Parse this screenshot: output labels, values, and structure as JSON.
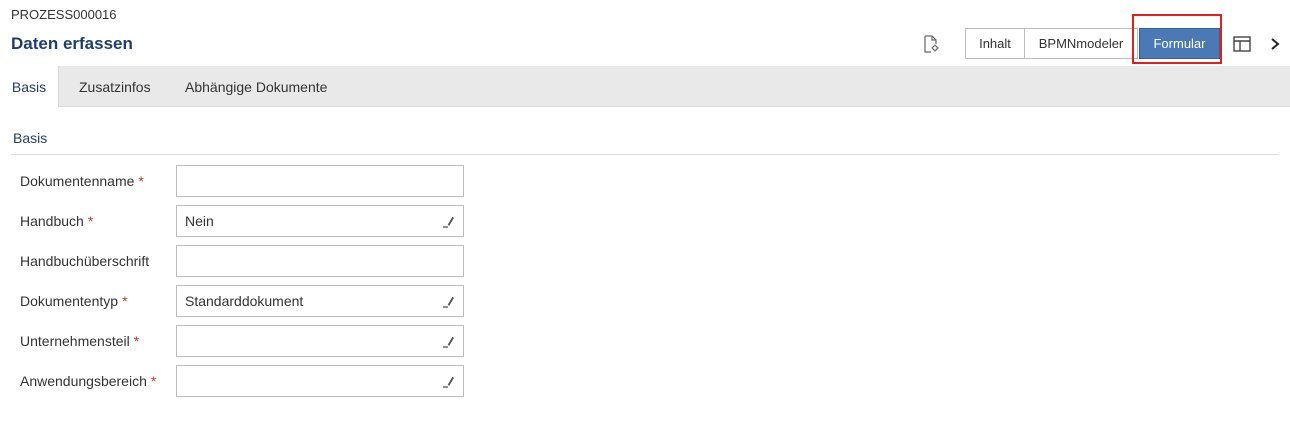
{
  "header": {
    "process_id": "PROZESS000016",
    "title": "Daten erfassen"
  },
  "toolbar": {
    "doc_icon": "document-settings-icon",
    "view_buttons": [
      "Inhalt",
      "BPMNmodeler",
      "Formular"
    ],
    "active_view": "Formular",
    "layout_icon": "panel-layout-icon",
    "more_icon": "chevron-right-icon",
    "accent_color": "#4a79b6",
    "highlight_color": "#e0201f"
  },
  "tabs": [
    {
      "label": "Basis",
      "active": true
    },
    {
      "label": "Zusatzinfos",
      "active": false
    },
    {
      "label": "Abhängige Dokumente",
      "active": false
    }
  ],
  "section": {
    "title": "Basis"
  },
  "fields": [
    {
      "label": "Dokumentenname",
      "required": "*",
      "value": "",
      "editable_picker": false
    },
    {
      "label": "Handbuch",
      "required": "*",
      "value": "Nein",
      "editable_picker": true
    },
    {
      "label": "Handbuchüberschrift",
      "required": "",
      "value": "",
      "editable_picker": false
    },
    {
      "label": "Dokumententyp",
      "required": "*",
      "value": "Standarddokument",
      "editable_picker": true
    },
    {
      "label": "Unternehmensteil",
      "required": "*",
      "value": "",
      "editable_picker": true
    },
    {
      "label": "Anwendungsbereich",
      "required": "*",
      "value": "",
      "editable_picker": true
    }
  ]
}
